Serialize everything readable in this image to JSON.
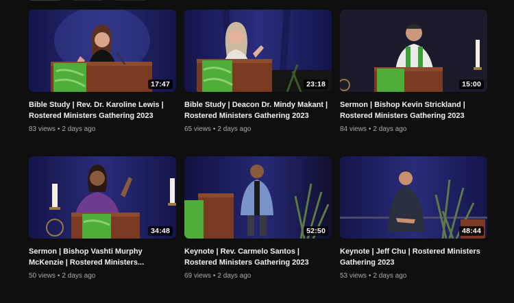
{
  "videos": [
    {
      "title": "Bible Study | Rev. Dr. Karoline Lewis | Rostered Ministers Gathering 2023",
      "duration": "17:47",
      "views": "83 views",
      "age": "2 days ago"
    },
    {
      "title": "Bible Study | Deacon Dr. Mindy Makant | Rostered Ministers Gathering 2023",
      "duration": "23:18",
      "views": "65 views",
      "age": "2 days ago"
    },
    {
      "title": "Sermon | Bishop Kevin Strickland | Rostered Ministers Gathering 2023",
      "duration": "15:00",
      "views": "84 views",
      "age": "2 days ago"
    },
    {
      "title": "Sermon | Bishop Vashti Murphy McKenzie | Rostered Ministers...",
      "duration": "34:48",
      "views": "50 views",
      "age": "2 days ago"
    },
    {
      "title": "Keynote | Rev. Carmelo Santos | Rostered Ministers Gathering 2023",
      "duration": "52:50",
      "views": "69 views",
      "age": "2 days ago"
    },
    {
      "title": "Keynote | Jeff Chu | Rostered Ministers Gathering 2023",
      "duration": "48:44",
      "views": "53 views",
      "age": "2 days ago"
    }
  ],
  "separator": "•",
  "colors": {
    "background": "#0f0f0f",
    "stage": "#1e1f5a",
    "podium": "#7a3a22",
    "banner_green": "#4fae3a",
    "meta_text": "#aaaaaa"
  }
}
